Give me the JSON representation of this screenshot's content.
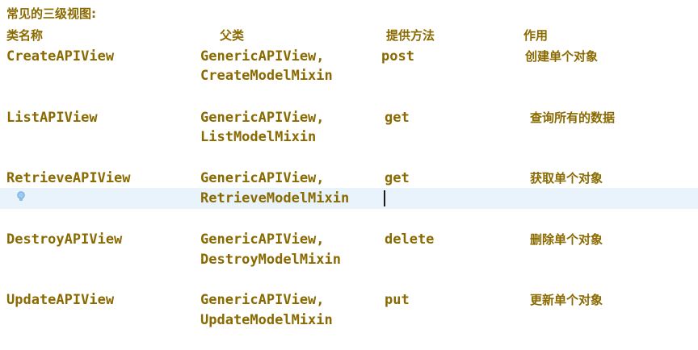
{
  "heading": "常见的三级视图:",
  "columns": {
    "class_name": "类名称",
    "parent": "父类",
    "method": "提供方法",
    "purpose": "作用"
  },
  "rows": [
    {
      "class_name": "CreateAPIView",
      "parent_1": "GenericAPIView,",
      "parent_2": "CreateModelMixin",
      "method": "post",
      "purpose": "创建单个对象"
    },
    {
      "class_name": "ListAPIView",
      "parent_1": "GenericAPIView,",
      "parent_2": "ListModelMixin",
      "method": "get",
      "purpose": "查询所有的数据"
    },
    {
      "class_name": "RetrieveAPIView",
      "parent_1": "GenericAPIView,",
      "parent_2": "RetrieveModelMixin",
      "method": "get",
      "purpose": "获取单个对象"
    },
    {
      "class_name": "DestroyAPIView",
      "parent_1": "GenericAPIView,",
      "parent_2": "DestroyModelMixin",
      "method": "delete",
      "purpose": "删除单个对象"
    },
    {
      "class_name": "UpdateAPIView",
      "parent_1": "GenericAPIView,",
      "parent_2": "UpdateModelMixin",
      "method": "put",
      "purpose": "更新单个对象"
    }
  ],
  "icons": {
    "gutter_hint": "lightbulb-icon"
  },
  "colors": {
    "text": "#8a6a00",
    "current_line": "#e9f3fb",
    "background": "#ffffff"
  }
}
